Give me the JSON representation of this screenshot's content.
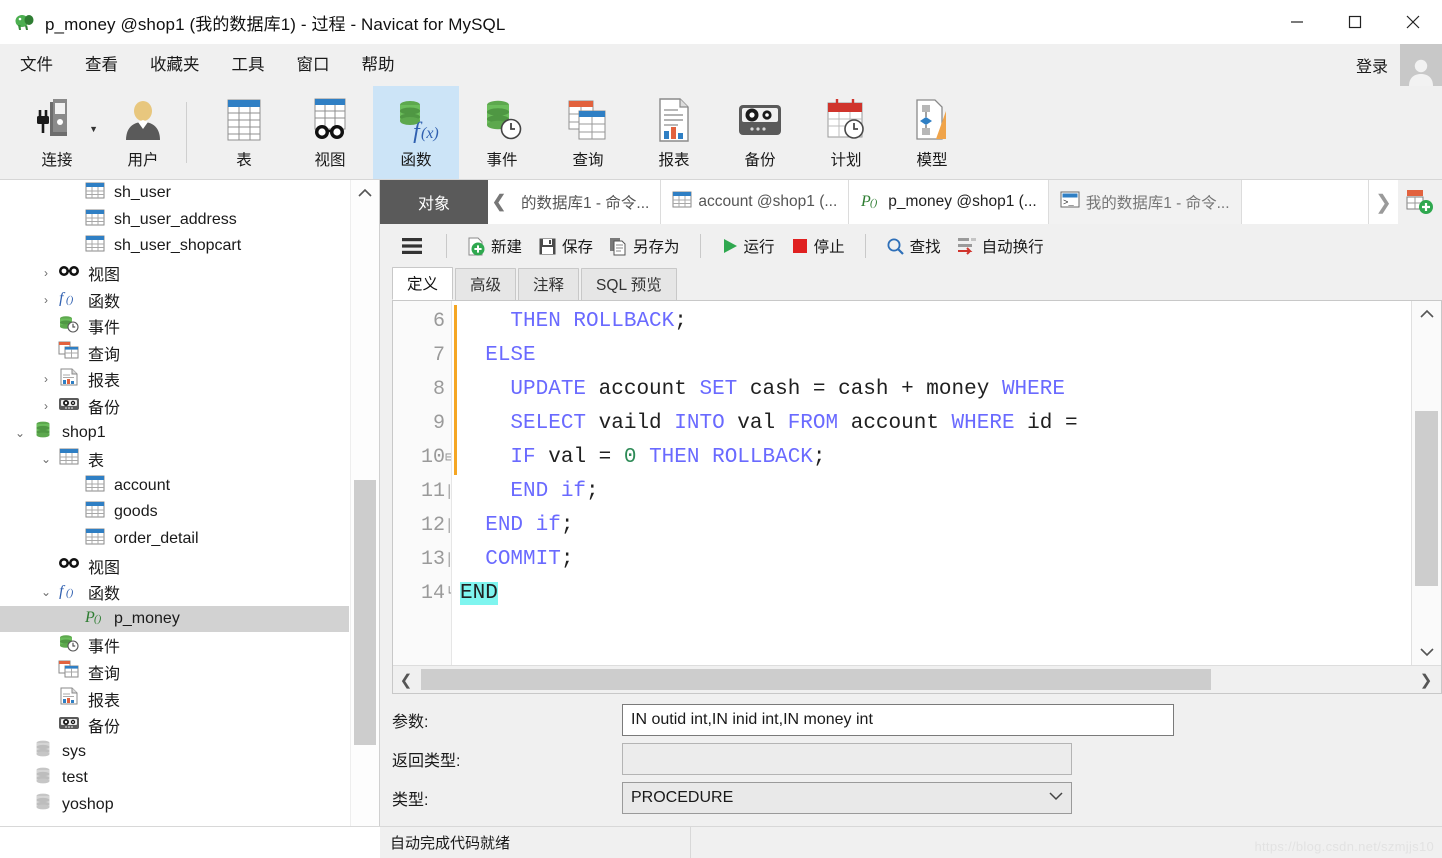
{
  "window": {
    "title": "p_money @shop1 (我的数据库1) - 过程 - Navicat for MySQL",
    "app_icon": "navicat-elephant-icon",
    "minimize": "−",
    "maximize": "□",
    "close": "✕"
  },
  "menubar": {
    "items": [
      {
        "label": "文件",
        "name": "menu-file"
      },
      {
        "label": "查看",
        "name": "menu-view"
      },
      {
        "label": "收藏夹",
        "name": "menu-favorites"
      },
      {
        "label": "工具",
        "name": "menu-tools"
      },
      {
        "label": "窗口",
        "name": "menu-window"
      },
      {
        "label": "帮助",
        "name": "menu-help"
      }
    ],
    "login_label": "登录"
  },
  "ribbon": {
    "items": [
      {
        "label": "连接",
        "icon": "connection-icon",
        "active": false,
        "has_caret": true
      },
      {
        "label": "用户",
        "icon": "user-icon",
        "active": false,
        "has_caret": false
      },
      {
        "label": "表",
        "icon": "table-icon",
        "active": false,
        "has_caret": false
      },
      {
        "label": "视图",
        "icon": "view-glasses-icon",
        "active": false,
        "has_caret": false
      },
      {
        "label": "函数",
        "icon": "function-fx-icon",
        "active": true,
        "has_caret": false
      },
      {
        "label": "事件",
        "icon": "event-clock-icon",
        "active": false,
        "has_caret": false
      },
      {
        "label": "查询",
        "icon": "query-icon",
        "active": false,
        "has_caret": false
      },
      {
        "label": "报表",
        "icon": "report-icon",
        "active": false,
        "has_caret": false
      },
      {
        "label": "备份",
        "icon": "backup-tape-icon",
        "active": false,
        "has_caret": false
      },
      {
        "label": "计划",
        "icon": "schedule-calendar-icon",
        "active": false,
        "has_caret": false
      },
      {
        "label": "模型",
        "icon": "model-diagram-icon",
        "active": false,
        "has_caret": false
      }
    ]
  },
  "sidebar": {
    "nodes": [
      {
        "label": "sh_user",
        "icon": "table-icon",
        "indent": 3,
        "arrow": "",
        "selected": false
      },
      {
        "label": "sh_user_address",
        "icon": "table-icon",
        "indent": 3,
        "arrow": "",
        "selected": false
      },
      {
        "label": "sh_user_shopcart",
        "icon": "table-icon",
        "indent": 3,
        "arrow": "",
        "selected": false
      },
      {
        "label": "视图",
        "icon": "view-glasses-icon",
        "indent": 2,
        "arrow": "›",
        "selected": false
      },
      {
        "label": "函数",
        "icon": "function-fx-icon",
        "indent": 2,
        "arrow": "›",
        "selected": false
      },
      {
        "label": "事件",
        "icon": "event-clock-icon",
        "indent": 2,
        "arrow": "",
        "selected": false
      },
      {
        "label": "查询",
        "icon": "query-icon",
        "indent": 2,
        "arrow": "",
        "selected": false
      },
      {
        "label": "报表",
        "icon": "report-icon",
        "indent": 2,
        "arrow": "›",
        "selected": false
      },
      {
        "label": "备份",
        "icon": "backup-tape-icon",
        "indent": 2,
        "arrow": "›",
        "selected": false
      },
      {
        "label": "shop1",
        "icon": "database-green-icon",
        "indent": 1,
        "arrow": "⌄",
        "selected": false
      },
      {
        "label": "表",
        "icon": "table-icon",
        "indent": 2,
        "arrow": "⌄",
        "selected": false
      },
      {
        "label": "account",
        "icon": "table-icon",
        "indent": 3,
        "arrow": "",
        "selected": false
      },
      {
        "label": "goods",
        "icon": "table-icon",
        "indent": 3,
        "arrow": "",
        "selected": false
      },
      {
        "label": "order_detail",
        "icon": "table-icon",
        "indent": 3,
        "arrow": "",
        "selected": false
      },
      {
        "label": "视图",
        "icon": "view-glasses-icon",
        "indent": 2,
        "arrow": "",
        "selected": false
      },
      {
        "label": "函数",
        "icon": "function-fx-icon",
        "indent": 2,
        "arrow": "⌄",
        "selected": false
      },
      {
        "label": "p_money",
        "icon": "procedure-icon",
        "indent": 3,
        "arrow": "",
        "selected": true
      },
      {
        "label": "事件",
        "icon": "event-clock-icon",
        "indent": 2,
        "arrow": "",
        "selected": false
      },
      {
        "label": "查询",
        "icon": "query-icon",
        "indent": 2,
        "arrow": "",
        "selected": false
      },
      {
        "label": "报表",
        "icon": "report-icon",
        "indent": 2,
        "arrow": "",
        "selected": false
      },
      {
        "label": "备份",
        "icon": "backup-tape-icon",
        "indent": 2,
        "arrow": "",
        "selected": false
      },
      {
        "label": "sys",
        "icon": "database-gray-icon",
        "indent": 1,
        "arrow": "",
        "selected": false
      },
      {
        "label": "test",
        "icon": "database-gray-icon",
        "indent": 1,
        "arrow": "",
        "selected": false
      },
      {
        "label": "yoshop",
        "icon": "database-gray-icon",
        "indent": 1,
        "arrow": "",
        "selected": false
      }
    ]
  },
  "tabstrip": {
    "object_tab": "对象",
    "scroll_left": "❮",
    "scroll_right": "❯",
    "add_tab_icon": "new-tab-plus-icon",
    "tabs": [
      {
        "label": "的数据库1 - 命令...",
        "icon": "console-icon",
        "state": "normal"
      },
      {
        "label": "account @shop1 (...",
        "icon": "table-icon",
        "state": "normal"
      },
      {
        "label": "p_money @shop1 (...",
        "icon": "procedure-icon",
        "state": "current"
      },
      {
        "label": "我的数据库1 - 命令...",
        "icon": "console-icon",
        "state": "inactive"
      }
    ]
  },
  "editor_toolbar": {
    "menu_icon": "hamburger-menu-icon",
    "buttons": [
      {
        "label": "新建",
        "icon": "new-plus-icon"
      },
      {
        "label": "保存",
        "icon": "save-disk-icon"
      },
      {
        "label": "另存为",
        "icon": "save-as-icon"
      },
      {
        "label": "运行",
        "icon": "run-play-icon"
      },
      {
        "label": "停止",
        "icon": "stop-square-icon"
      },
      {
        "label": "查找",
        "icon": "search-magnifier-icon"
      },
      {
        "label": "自动换行",
        "icon": "word-wrap-icon"
      }
    ]
  },
  "subtabs": [
    {
      "label": "定义",
      "active": true
    },
    {
      "label": "高级",
      "active": false
    },
    {
      "label": "注释",
      "active": false
    },
    {
      "label": "SQL 预览",
      "active": false
    }
  ],
  "code": {
    "first_line_number": 6,
    "lines": [
      {
        "n": 6,
        "fold": "",
        "tokens": [
          {
            "t": "    ",
            "c": "plain"
          },
          {
            "t": "THEN ROLLBACK",
            "c": "kw"
          },
          {
            "t": ";",
            "c": "plain"
          }
        ]
      },
      {
        "n": 7,
        "fold": "",
        "tokens": [
          {
            "t": "  ",
            "c": "plain"
          },
          {
            "t": "ELSE",
            "c": "kw"
          }
        ]
      },
      {
        "n": 8,
        "fold": "",
        "tokens": [
          {
            "t": "    ",
            "c": "plain"
          },
          {
            "t": "UPDATE",
            "c": "kw"
          },
          {
            "t": " account ",
            "c": "plain"
          },
          {
            "t": "SET",
            "c": "kw"
          },
          {
            "t": " cash = cash + money ",
            "c": "plain"
          },
          {
            "t": "WHERE",
            "c": "kw"
          }
        ]
      },
      {
        "n": 9,
        "fold": "",
        "tokens": [
          {
            "t": "    ",
            "c": "plain"
          },
          {
            "t": "SELECT",
            "c": "kw"
          },
          {
            "t": " vaild ",
            "c": "plain"
          },
          {
            "t": "INTO",
            "c": "kw"
          },
          {
            "t": " val ",
            "c": "plain"
          },
          {
            "t": "FROM",
            "c": "kw"
          },
          {
            "t": " account ",
            "c": "plain"
          },
          {
            "t": "WHERE",
            "c": "kw"
          },
          {
            "t": " id =",
            "c": "plain"
          }
        ]
      },
      {
        "n": 10,
        "fold": "⊟",
        "tokens": [
          {
            "t": "    ",
            "c": "plain"
          },
          {
            "t": "IF",
            "c": "kw"
          },
          {
            "t": " val = ",
            "c": "plain"
          },
          {
            "t": "0",
            "c": "num"
          },
          {
            "t": " ",
            "c": "plain"
          },
          {
            "t": "THEN ROLLBACK",
            "c": "kw"
          },
          {
            "t": ";",
            "c": "plain"
          }
        ]
      },
      {
        "n": 11,
        "fold": "│",
        "tokens": [
          {
            "t": "    ",
            "c": "plain"
          },
          {
            "t": "END if",
            "c": "kw"
          },
          {
            "t": ";",
            "c": "plain"
          }
        ]
      },
      {
        "n": 12,
        "fold": "│",
        "tokens": [
          {
            "t": "  ",
            "c": "plain"
          },
          {
            "t": "END if",
            "c": "kw"
          },
          {
            "t": ";",
            "c": "plain"
          }
        ]
      },
      {
        "n": 13,
        "fold": "│",
        "tokens": [
          {
            "t": "  ",
            "c": "plain"
          },
          {
            "t": "COMMIT",
            "c": "kw"
          },
          {
            "t": ";",
            "c": "plain"
          }
        ]
      },
      {
        "n": 14,
        "fold": "└",
        "tokens": [
          {
            "t": "END",
            "c": "hl"
          }
        ]
      }
    ]
  },
  "form": {
    "rows": [
      {
        "label": "参数:",
        "value": "IN outid int,IN inid int,IN money int",
        "kind": "text",
        "name": "parameters-field"
      },
      {
        "label": "返回类型:",
        "value": "",
        "kind": "readonly",
        "name": "return-type-field"
      },
      {
        "label": "类型:",
        "value": "PROCEDURE",
        "kind": "select",
        "name": "routine-type-select"
      }
    ]
  },
  "statusbar": {
    "message": "自动完成代码就绪",
    "watermark": "https://blog.csdn.net/szmjjs10"
  }
}
